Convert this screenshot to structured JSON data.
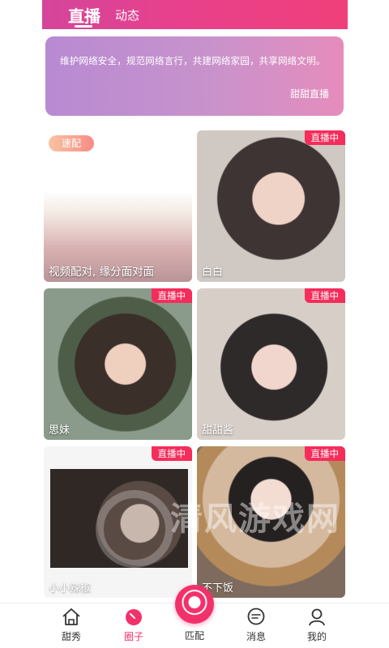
{
  "header": {
    "tabs": [
      {
        "label": "直播",
        "active": true
      },
      {
        "label": "动态",
        "active": false
      }
    ],
    "colors": {
      "gradient_start": "#d4459a",
      "gradient_end": "#f0407a"
    }
  },
  "notice": {
    "text": "维护网络安全，规范网络言行，共建网络家园，共享网络文明。",
    "source": "甜甜直播"
  },
  "cards": [
    {
      "title": "视频配对, 缘分面对面",
      "badge": "速配"
    },
    {
      "title": "白白",
      "badge": "直播中"
    },
    {
      "title": "思妹",
      "badge": "直播中"
    },
    {
      "title": "甜甜酱",
      "badge": "直播中"
    },
    {
      "title": "小小辣椒",
      "badge": "直播中"
    },
    {
      "title": "不下饭",
      "badge": "直播中"
    }
  ],
  "watermark": {
    "text": "清风游戏网"
  },
  "bottom_nav": {
    "items": [
      {
        "label": "甜秀",
        "icon": "home-icon",
        "active": false
      },
      {
        "label": "圈子",
        "icon": "circle-icon",
        "active": true
      },
      {
        "label": "匹配",
        "icon": "match-icon",
        "active": false
      },
      {
        "label": "消息",
        "icon": "message-icon",
        "active": false
      },
      {
        "label": "我的",
        "icon": "profile-icon",
        "active": false
      }
    ],
    "accent": "#f2316b"
  }
}
